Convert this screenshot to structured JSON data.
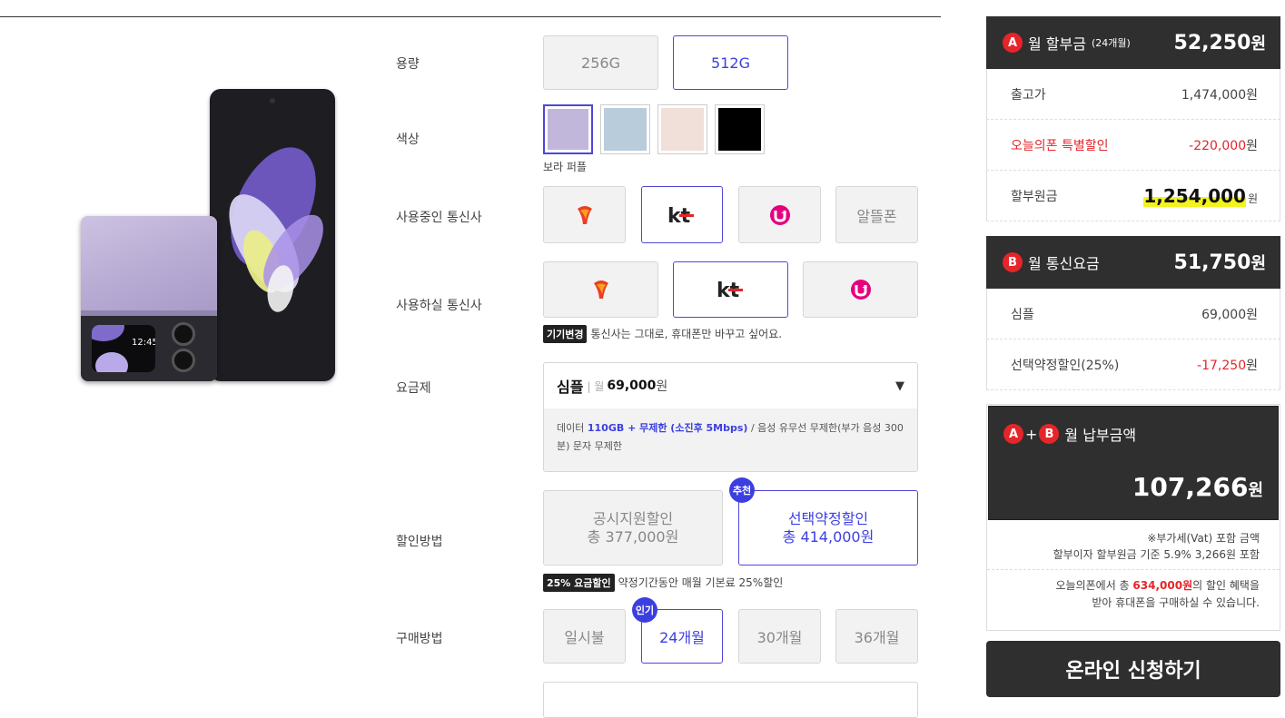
{
  "options": {
    "capacity": {
      "label": "용량",
      "items": [
        "256G",
        "512G"
      ],
      "selected": 1
    },
    "color": {
      "label": "색상",
      "swatches": [
        "#c0b7da",
        "#b9ccdc",
        "#f1dfda",
        "#000000"
      ],
      "selected": 0,
      "selected_name": "보라 퍼플"
    },
    "current_carrier": {
      "label": "사용중인 통신사",
      "items": [
        "SKT",
        "KT",
        "LG U+",
        "알뜰폰"
      ],
      "last_label": "알뜰폰",
      "selected": 1
    },
    "target_carrier": {
      "label": "사용하실 통신사",
      "items": [
        "SKT",
        "KT",
        "LG U+"
      ],
      "selected": 1,
      "tag": "기기변경",
      "note": "통신사는 그대로, 휴대폰만 바꾸고 싶어요."
    },
    "plan": {
      "label": "요금제",
      "name": "심플",
      "prefix": "| 월",
      "price": "69,000",
      "unit": "원",
      "desc_1": "데이터 ",
      "desc_hl": "110GB + 무제한 (소진후 5Mbps)",
      "desc_2": " / 음성 유무선 무제한(부가 음성 300분) 문자 무제한"
    },
    "discount": {
      "label": "할인방법",
      "left_l1": "공시지원할인",
      "left_l2": "총 377,000원",
      "right_l1": "선택약정할인",
      "right_l2": "총 414,000원",
      "badge": "추천",
      "tag": "25% 요금할인",
      "note": "약정기간동안 매월 기본료 25%할인"
    },
    "purchase": {
      "label": "구매방법",
      "items": [
        "일시불",
        "24개월",
        "30개월",
        "36개월"
      ],
      "selected": 1,
      "badge": "인기"
    }
  },
  "phone": {
    "cover_time": "12:45"
  },
  "summary": {
    "a_circle": "A",
    "b_circle": "B",
    "a_title": "월 할부금",
    "a_sub": "(24개월)",
    "a_amount": "52,250",
    "won": "원",
    "rows_a": [
      {
        "label": "출고가",
        "value": "1,474,000",
        "unit": "원"
      },
      {
        "label": "오늘의폰 특별할인",
        "value": "-220,000",
        "unit": "원"
      },
      {
        "label": "할부원금",
        "value": "1,254,000",
        "unit": "원"
      }
    ],
    "b_title": "월 통신요금",
    "b_amount": "51,750",
    "rows_b": [
      {
        "label": "심플",
        "value": "69,000",
        "unit": "원"
      },
      {
        "label": "선택약정할인(25%)",
        "value": "-17,250",
        "unit": "원"
      }
    ],
    "total_plus": "+",
    "total_title": "월 납부금액",
    "total_amount": "107,266",
    "vat_note": "※부가세(Vat) 포함 금액",
    "interest_note": "할부이자 할부원금 기준 5.9% 3,266원 포함",
    "benefit_1": "오늘의폰에서 총 ",
    "benefit_amount": "634,000원",
    "benefit_2": "의 할인 혜택을",
    "benefit_3": "받아 휴대폰을 구매하실 수 있습니다.",
    "apply_label": "온라인 신청하기"
  },
  "colors": {
    "accent": "#3c3fe0",
    "red": "#e5252a",
    "dark": "#2f2f2f",
    "highlight": "#f3f31e"
  }
}
